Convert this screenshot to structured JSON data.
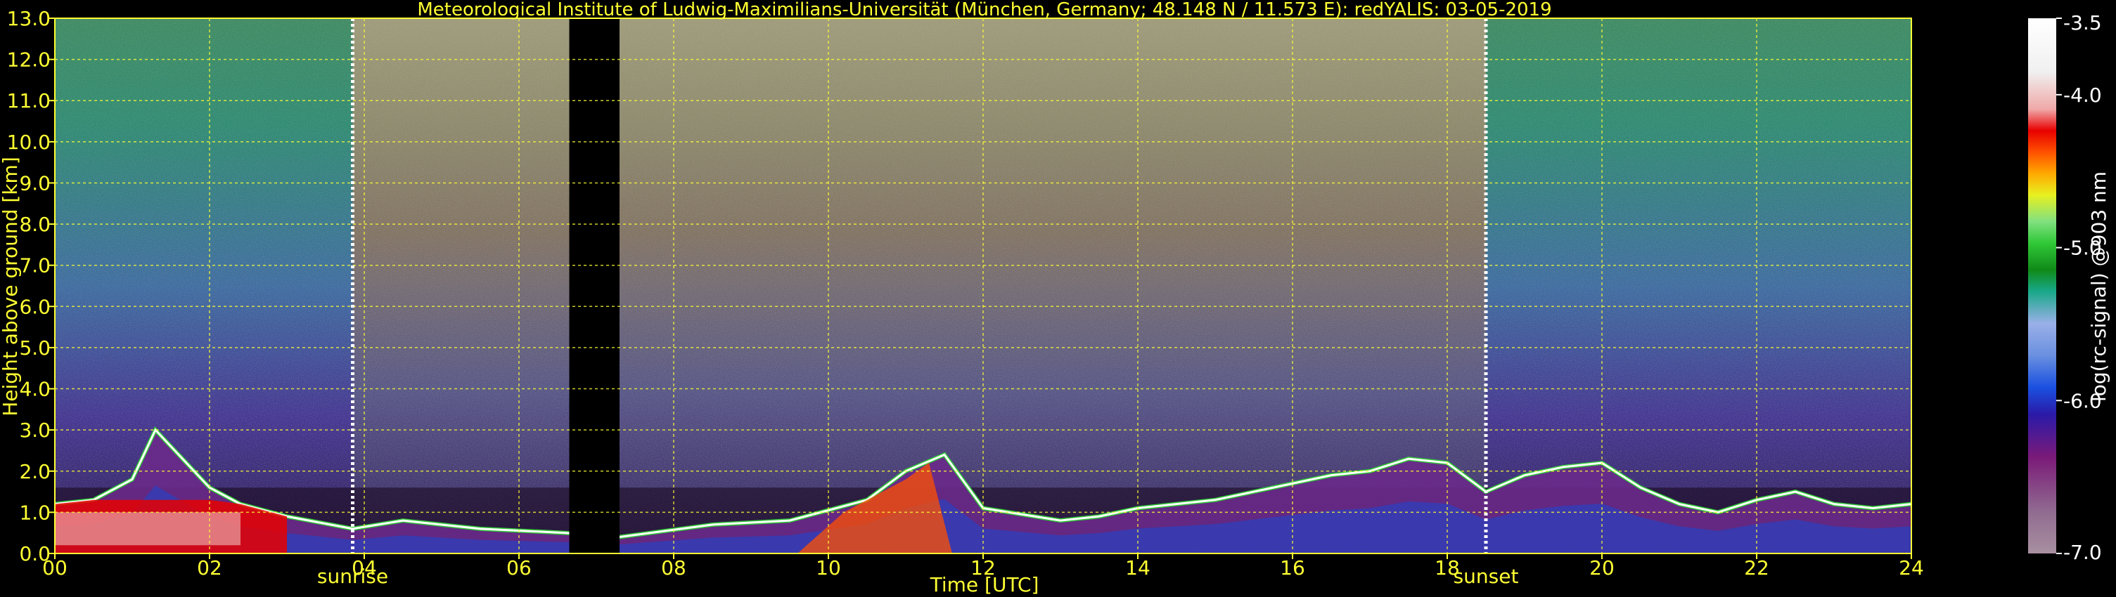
{
  "chart_data": {
    "type": "heatmap",
    "title": "Meteorological Institute of Ludwig-Maximilians-Universität (München, Germany; 48.148 N / 11.573 E):    redYALIS: 03-05-2019",
    "xlabel": "Time [UTC]",
    "ylabel": "Height above ground [km]",
    "colorbar_label": "log(rc-signal) @903 nm",
    "xlim": [
      0,
      24
    ],
    "ylim": [
      0,
      13
    ],
    "clim": [
      -7.0,
      -3.5
    ],
    "x_ticks": [
      0,
      2,
      4,
      6,
      8,
      10,
      12,
      14,
      16,
      18,
      20,
      22,
      24
    ],
    "x_tick_labels": [
      "00",
      "02",
      "04",
      "06",
      "08",
      "10",
      "12",
      "14",
      "16",
      "18",
      "20",
      "22",
      "24"
    ],
    "y_ticks": [
      0,
      1,
      2,
      3,
      4,
      5,
      6,
      7,
      8,
      9,
      10,
      11,
      12,
      13
    ],
    "y_tick_labels": [
      "0.0",
      "1.0",
      "2.0",
      "3.0",
      "4.0",
      "5.0",
      "6.0",
      "7.0",
      "8.0",
      "9.0",
      "10.0",
      "11.0",
      "12.0",
      "13.0"
    ],
    "colorbar_ticks": [
      -3.5,
      -4.0,
      -5.0,
      -6.0,
      -7.0
    ],
    "colorbar_tick_labels": [
      "-3.5",
      "-4.0",
      "-5.0",
      "-6.0",
      "-7.0"
    ],
    "grid": true,
    "colormap": [
      "#a890a0",
      "#906a90",
      "#7a1a78",
      "#2a1aa8",
      "#1a50e0",
      "#6a90e0",
      "#9ab0e8",
      "#18a888",
      "#108a18",
      "#30c838",
      "#80e080",
      "#e8f020",
      "#ffa800",
      "#ff5000",
      "#e80000",
      "#f0a8a8",
      "#f0f0f0",
      "#ffffff"
    ],
    "markers": [
      {
        "label": "sunrise",
        "x": 3.85
      },
      {
        "label": "sunset",
        "x": 18.5
      }
    ],
    "data_gap": [
      6.65,
      7.3
    ],
    "boundary_layer_top_km": {
      "x": [
        0,
        0.5,
        1.0,
        1.3,
        1.6,
        2.0,
        2.4,
        3.0,
        3.85,
        4.5,
        5.5,
        6.6,
        7.3,
        8.5,
        9.5,
        10.5,
        11.0,
        11.5,
        12.0,
        13.0,
        13.5,
        14.0,
        14.5,
        15.0,
        15.5,
        16.0,
        16.5,
        17.0,
        17.5,
        18.0,
        18.5,
        19.0,
        19.5,
        20.0,
        20.5,
        21.0,
        21.5,
        22.0,
        22.5,
        23.0,
        23.5,
        24.0
      ],
      "y": [
        1.2,
        1.3,
        1.8,
        3.0,
        2.4,
        1.6,
        1.2,
        0.9,
        0.6,
        0.8,
        0.6,
        0.5,
        0.4,
        0.7,
        0.8,
        1.3,
        2.0,
        2.4,
        1.1,
        0.8,
        0.9,
        1.1,
        1.2,
        1.3,
        1.5,
        1.7,
        1.9,
        2.0,
        2.3,
        2.2,
        1.5,
        1.9,
        2.1,
        2.2,
        1.6,
        1.2,
        1.0,
        1.3,
        1.5,
        1.2,
        1.1,
        1.2
      ]
    }
  }
}
